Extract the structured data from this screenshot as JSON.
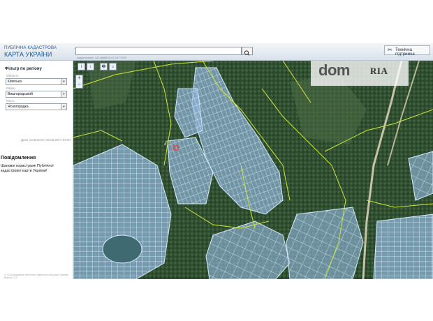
{
  "header": {
    "brand_line1": "ПУБЛІЧНА КАДАСТРОВА",
    "brand_line2": "КАРТА УКРАЇНИ",
    "search_placeholder": "",
    "cadastral_hint": "кадастровий: 3221888803:01:047:0025",
    "support_label": "Технічна підтримка"
  },
  "sidebar": {
    "filter_title": "Фільтр по регіону",
    "fields": [
      {
        "label": "Область",
        "value": "Київська"
      },
      {
        "label": "Район",
        "value": "Вишгородський"
      },
      {
        "label": "Місто",
        "value": "Ясногородка"
      }
    ],
    "updated": "Дата оновлення: 26.06.2017 03:00",
    "notifications_title": "Повідомлення",
    "notifications_text": "Шановні користувачі Публічної кадастрової карти України!",
    "footer": "© 2013 Державне агентство земельних ресурсів України. Версія 1.13"
  },
  "map": {
    "toolbar": [
      "i",
      "↕",
      "🖶",
      "⌂"
    ],
    "zoom": [
      "+",
      "−"
    ],
    "logo_dom": "dom",
    "logo_ria": "RIA",
    "colors": {
      "parcel_fill": "#8fb4d8",
      "parcel_stroke": "#d8ecff",
      "boundary": "#d8e63a",
      "forest": "#2e4d2e"
    }
  }
}
